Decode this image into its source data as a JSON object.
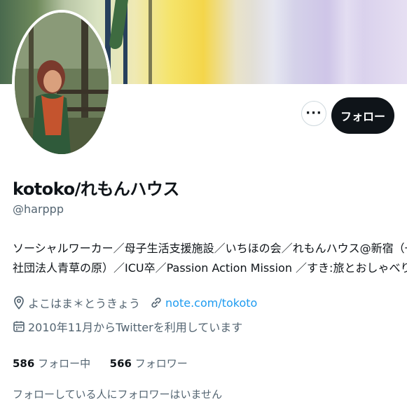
{
  "profile": {
    "display_name": "kotoko/れもんハウス",
    "handle": "@harppp",
    "bio_lines": [
      "ソーシャルワーカー／母子生活支援施設／いちほの会／れもんハウス@新宿（一般",
      "社団法人青草の原）／ICU卒／Passion Action Mission ／すき:旅とおしゃべり"
    ],
    "location": "よこはま＊とうきょう",
    "website": "note.com/tokoto",
    "joined": "2010年11月からTwitterを利用しています",
    "following_count": "586",
    "following_label": "フォロー中",
    "followers_count": "566",
    "followers_label": "フォロワー",
    "mutual_notice": "フォローしている人にフォロワーはいません"
  },
  "actions": {
    "more_label": "···",
    "follow_label": "フォロー"
  },
  "icons": {
    "more": "more-horizontal-icon",
    "location": "location-pin-icon",
    "link": "link-icon",
    "calendar": "calendar-icon"
  },
  "colors": {
    "link": "#1d9bf0",
    "follow_button_bg": "#0f1419",
    "secondary_text": "#536471"
  }
}
